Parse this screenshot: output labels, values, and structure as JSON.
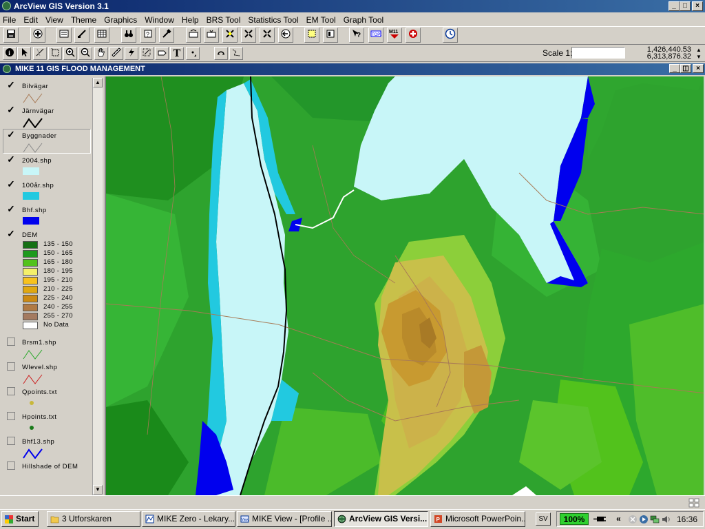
{
  "app": {
    "title": "ArcView GIS Version 3.1",
    "controls": {
      "minimize": "_",
      "maximize": "□",
      "close": "×"
    }
  },
  "menu": [
    "File",
    "Edit",
    "View",
    "Theme",
    "Graphics",
    "Window",
    "Help",
    "BRS Tool",
    "Statistics Tool",
    "EM Tool",
    "Graph Tool"
  ],
  "toolbar": {
    "buttons": [
      {
        "name": "save-project",
        "icon": "floppy-icon"
      },
      {
        "name": "add-theme",
        "icon": "plus-icon"
      },
      {
        "name": "theme-properties",
        "icon": "properties-icon"
      },
      {
        "name": "edit-legend",
        "icon": "legend-icon"
      },
      {
        "name": "open-table",
        "icon": "table-icon"
      },
      {
        "name": "find",
        "icon": "binoculars-icon"
      },
      {
        "name": "query",
        "icon": "query-icon"
      },
      {
        "name": "tools",
        "icon": "hammer-icon"
      },
      {
        "name": "zoom-full",
        "icon": "zoom-full-icon"
      },
      {
        "name": "zoom-active",
        "icon": "zoom-active-icon"
      },
      {
        "name": "zoom-selected",
        "icon": "zoom-selected-icon"
      },
      {
        "name": "zoom-in-fixed",
        "icon": "zoom-in-fixed-icon"
      },
      {
        "name": "zoom-out-fixed",
        "icon": "zoom-out-fixed-icon"
      },
      {
        "name": "zoom-previous",
        "icon": "zoom-previous-icon"
      },
      {
        "name": "select-features",
        "icon": "select-icon"
      },
      {
        "name": "clear-selection",
        "icon": "clear-icon"
      },
      {
        "name": "help",
        "icon": "help-icon"
      },
      {
        "name": "topo",
        "icon": "topo-icon"
      },
      {
        "name": "m11",
        "icon": "m11-icon"
      },
      {
        "name": "flood-tool",
        "icon": "flood-icon"
      },
      {
        "name": "clock",
        "icon": "clock-icon"
      }
    ]
  },
  "tools": [
    {
      "name": "identify",
      "icon": "identify-icon",
      "label": "i"
    },
    {
      "name": "pointer",
      "icon": "arrow-icon",
      "label": "↖"
    },
    {
      "name": "vertex-edit",
      "icon": "vertex-icon",
      "label": "⟋"
    },
    {
      "name": "select-feature",
      "icon": "select-box-icon",
      "label": "▫"
    },
    {
      "name": "zoom-in",
      "icon": "zoom-in-icon",
      "label": "⊕"
    },
    {
      "name": "zoom-out",
      "icon": "zoom-out-icon",
      "label": "⊖"
    },
    {
      "name": "pan",
      "icon": "hand-icon",
      "label": "✋"
    },
    {
      "name": "measure",
      "icon": "ruler-icon",
      "label": "📏"
    },
    {
      "name": "hotlink",
      "icon": "lightning-icon",
      "label": "⚡"
    },
    {
      "name": "area-of-interest",
      "icon": "area-icon",
      "label": "▦"
    },
    {
      "name": "label",
      "icon": "label-icon",
      "label": "🏷"
    },
    {
      "name": "text",
      "icon": "text-icon",
      "label": "T"
    },
    {
      "name": "draw-point",
      "icon": "draw-icon",
      "label": "•"
    },
    {
      "name": "snap",
      "icon": "snap-icon",
      "label": "⌔"
    },
    {
      "name": "edit-shape",
      "icon": "shape-icon",
      "label": "⌇"
    }
  ],
  "scale": {
    "label": "Scale 1:",
    "value": ""
  },
  "coordinates": {
    "x": "1,426,440.53",
    "y": "6,313,876.32"
  },
  "view": {
    "title": "MIKE 11 GIS FLOOD MANAGEMENT",
    "controls": {
      "minimize": "_",
      "restore": "◫",
      "close": "×"
    }
  },
  "toc": {
    "layers": [
      {
        "name": "Bilvägar",
        "checked": true,
        "type": "line",
        "color": "#a87a56"
      },
      {
        "name": "Järnvägar",
        "checked": true,
        "type": "line",
        "color": "#000000"
      },
      {
        "name": "Byggnader",
        "checked": true,
        "type": "line",
        "color": "#8a8a8a",
        "selected": true
      },
      {
        "name": "2004.shp",
        "checked": true,
        "type": "fill",
        "color": "#c8f6f8"
      },
      {
        "name": "100år.shp",
        "checked": true,
        "type": "fill",
        "color": "#22c9e0"
      },
      {
        "name": "Bhf.shp",
        "checked": true,
        "type": "fill",
        "color": "#0000ee"
      },
      {
        "name": "DEM",
        "checked": true,
        "type": "legend"
      },
      {
        "name": "Brsm1.shp",
        "checked": false,
        "type": "line",
        "color": "#2aa82a"
      },
      {
        "name": "Wlevel.shp",
        "checked": false,
        "type": "line",
        "color": "#cc1e1e"
      },
      {
        "name": "Qpoints.txt",
        "checked": false,
        "type": "point",
        "color": "#c8b83a"
      },
      {
        "name": "Hpoints.txt",
        "checked": false,
        "type": "point",
        "color": "#1a7a1a"
      },
      {
        "name": "Bhf13.shp",
        "checked": false,
        "type": "line",
        "color": "#0000ee"
      },
      {
        "name": "Hillshade of DEM",
        "checked": false,
        "type": "none"
      }
    ],
    "dem_legend": [
      {
        "label": "135 - 150",
        "color": "#157015"
      },
      {
        "label": "150 - 165",
        "color": "#1e9a1e"
      },
      {
        "label": "165 - 180",
        "color": "#52c21c"
      },
      {
        "label": "180 - 195",
        "color": "#f4f06a"
      },
      {
        "label": "195 - 210",
        "color": "#f7c21e"
      },
      {
        "label": "210 - 225",
        "color": "#e0a812"
      },
      {
        "label": "225 - 240",
        "color": "#cc8a14"
      },
      {
        "label": "240 - 255",
        "color": "#b07a44"
      },
      {
        "label": "255 - 270",
        "color": "#a47a60"
      },
      {
        "label": "No Data",
        "color": "#ffffff"
      }
    ]
  },
  "taskbar": {
    "start": "Start",
    "tasks": [
      {
        "label": "3 Utforskaren",
        "icon": "folder-icon",
        "active": false
      },
      {
        "label": "MIKE Zero - Lekary...",
        "icon": "mike-zero-icon",
        "active": false
      },
      {
        "label": "MIKE View - [Profile ...",
        "icon": "mike-view-icon",
        "active": false
      },
      {
        "label": "ArcView GIS Versi...",
        "icon": "arcview-icon",
        "active": true
      },
      {
        "label": "Microsoft PowerPoin...",
        "icon": "powerpoint-icon",
        "active": false
      }
    ],
    "language": "SV",
    "battery": "100%",
    "time": "16:36",
    "tray_chevron": "«"
  },
  "colors": {
    "titlebar": "#0a246a",
    "lake": "#c8f6f8",
    "flood": "#22c9e0",
    "deep": "#0000ee",
    "green": "#2fa62f"
  }
}
